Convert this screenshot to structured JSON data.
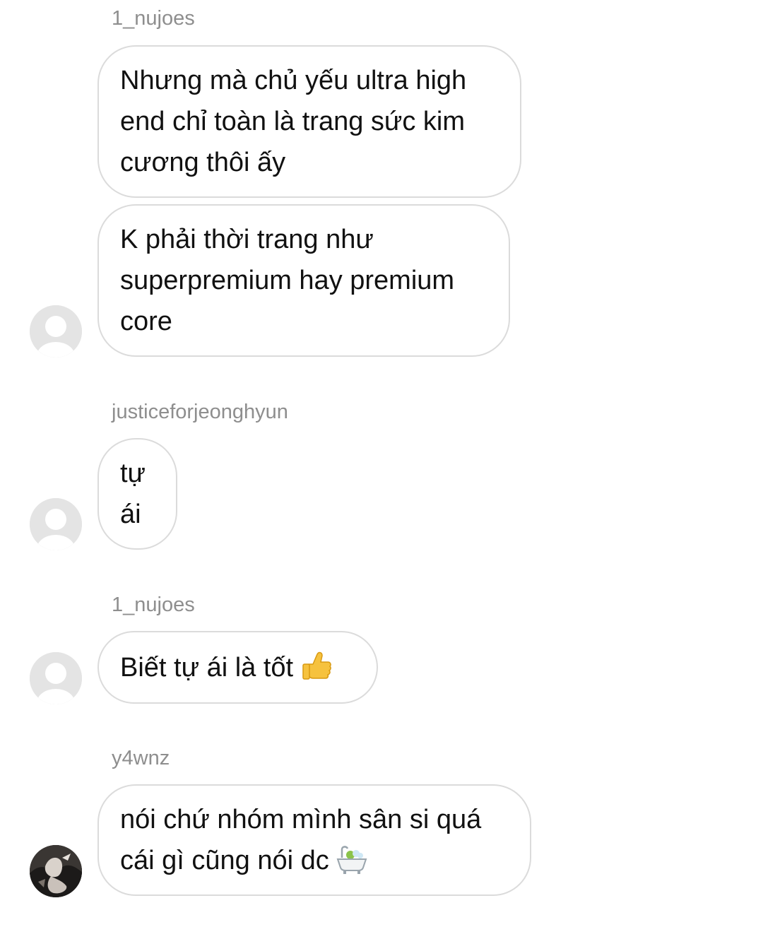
{
  "messages": [
    {
      "username": "1_nujoes",
      "bubbles": [
        {
          "text": "Nhưng mà chủ yếu ultra high\nend chỉ toàn là trang sức kim\ncương thôi ấy"
        },
        {
          "text": "K phải thời trang như\nsuperpremium hay premium\ncore"
        }
      ]
    },
    {
      "username": "justiceforjeonghyun",
      "bubbles": [
        {
          "text": "tự\nái"
        }
      ]
    },
    {
      "username": "1_nujoes",
      "bubbles": [
        {
          "text": "Biết tự ái là tốt",
          "emoji": "thumbs-up-icon"
        }
      ]
    },
    {
      "username": "y4wnz",
      "bubbles": [
        {
          "text": "nói chứ nhóm mình sân si quá\ncái gì cũng nói dc",
          "emoji": "bathtub-icon"
        }
      ]
    }
  ],
  "colors": {
    "username": "#8e8e8e",
    "bubble_border": "#dbdbdb",
    "text": "#111111",
    "avatar_placeholder": "#e4e4e4"
  }
}
